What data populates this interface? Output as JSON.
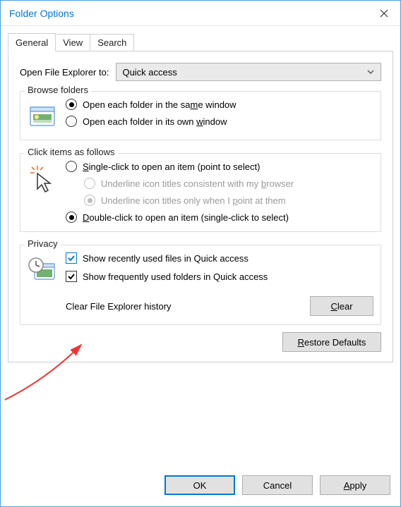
{
  "window": {
    "title": "Folder Options"
  },
  "tabs": {
    "general": "General",
    "view": "View",
    "search": "Search"
  },
  "open_to": {
    "label": "Open File Explorer to:",
    "value": "Quick access"
  },
  "browse": {
    "legend": "Browse folders",
    "same_pre": "Open each folder in the sa",
    "same_ul": "m",
    "same_post": "e window",
    "own_pre": "Open each folder in its own ",
    "own_ul": "w",
    "own_post": "indow"
  },
  "click": {
    "legend": "Click items as follows",
    "single_ul": "S",
    "single_post": "ingle-click to open an item (point to select)",
    "sub1_pre": "Underline icon titles consistent with my ",
    "sub1_ul": "b",
    "sub1_post": "rowser",
    "sub2_pre": "Underline icon titles only when I ",
    "sub2_ul": "p",
    "sub2_post": "oint at them",
    "double_ul": "D",
    "double_post": "ouble-click to open an item (single-click to select)"
  },
  "privacy": {
    "legend": "Privacy",
    "recent": "Show recently used files in Quick access",
    "frequent": "Show frequently used folders in Quick access",
    "clear_label": "Clear File Explorer history",
    "clear_btn_ul": "C",
    "clear_btn_post": "lear"
  },
  "restore": {
    "ul": "R",
    "post": "estore Defaults"
  },
  "footer": {
    "ok": "OK",
    "cancel": "Cancel",
    "apply_ul": "A",
    "apply_post": "pply"
  }
}
